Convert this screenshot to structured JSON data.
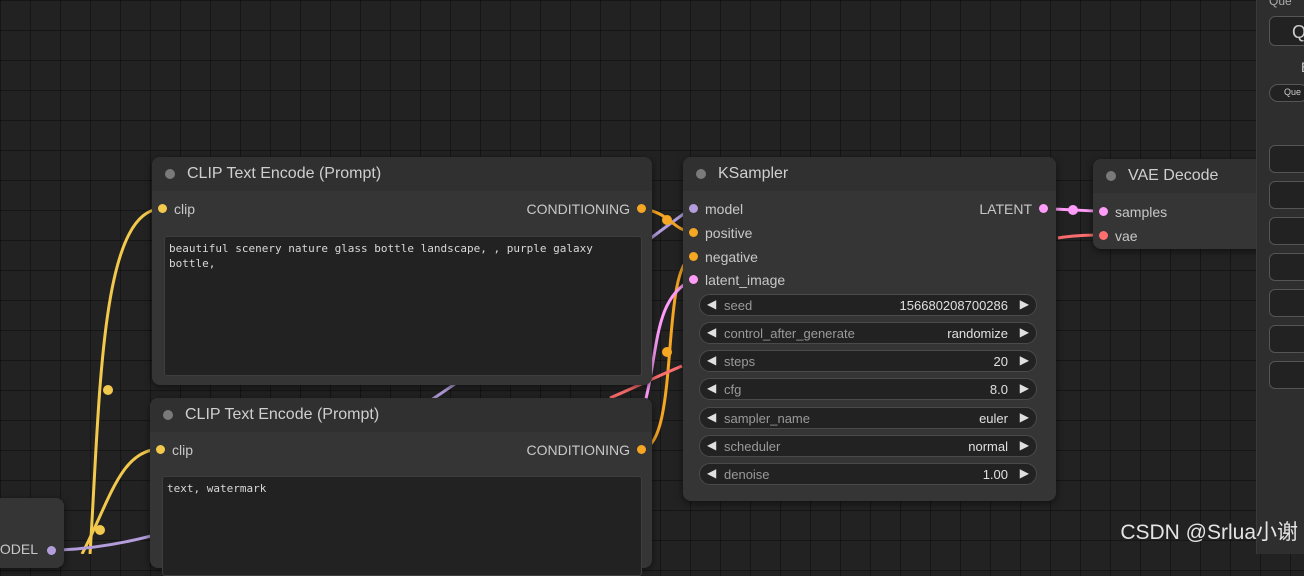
{
  "colors": {
    "clip": "#f2c94c",
    "conditioning": "#f5a623",
    "model": "#b39ddb",
    "latent": "#ff9cf9",
    "vae": "#ff6e6e"
  },
  "clip_positive": {
    "title": "CLIP Text Encode (Prompt)",
    "input_clip": "clip",
    "output_conditioning": "CONDITIONING",
    "prompt_text": "beautiful scenery nature glass bottle landscape, , purple galaxy bottle,"
  },
  "clip_negative": {
    "title": "CLIP Text Encode (Prompt)",
    "input_clip": "clip",
    "output_conditioning": "CONDITIONING",
    "prompt_text": "text, watermark"
  },
  "ksampler": {
    "title": "KSampler",
    "inputs": {
      "model": "model",
      "positive": "positive",
      "negative": "negative",
      "latent_image": "latent_image"
    },
    "output_latent": "LATENT",
    "widgets": {
      "seed": {
        "name": "seed",
        "value": "156680208700286"
      },
      "control_after_generate": {
        "name": "control_after_generate",
        "value": "randomize"
      },
      "steps": {
        "name": "steps",
        "value": "20"
      },
      "cfg": {
        "name": "cfg",
        "value": "8.0"
      },
      "sampler_name": {
        "name": "sampler_name",
        "value": "euler"
      },
      "scheduler": {
        "name": "scheduler",
        "value": "normal"
      },
      "denoise": {
        "name": "denoise",
        "value": "1.00"
      }
    }
  },
  "vae_decode": {
    "title": "VAE Decode",
    "input_samples": "samples",
    "input_vae": "vae"
  },
  "loader_partial": {
    "output_model": "MODEL"
  },
  "queue_panel": {
    "header": "Que",
    "button_partial": "Q",
    "small_label": "Que",
    "extra_partial": "E"
  },
  "watermark": "CSDN @Srlua小谢"
}
